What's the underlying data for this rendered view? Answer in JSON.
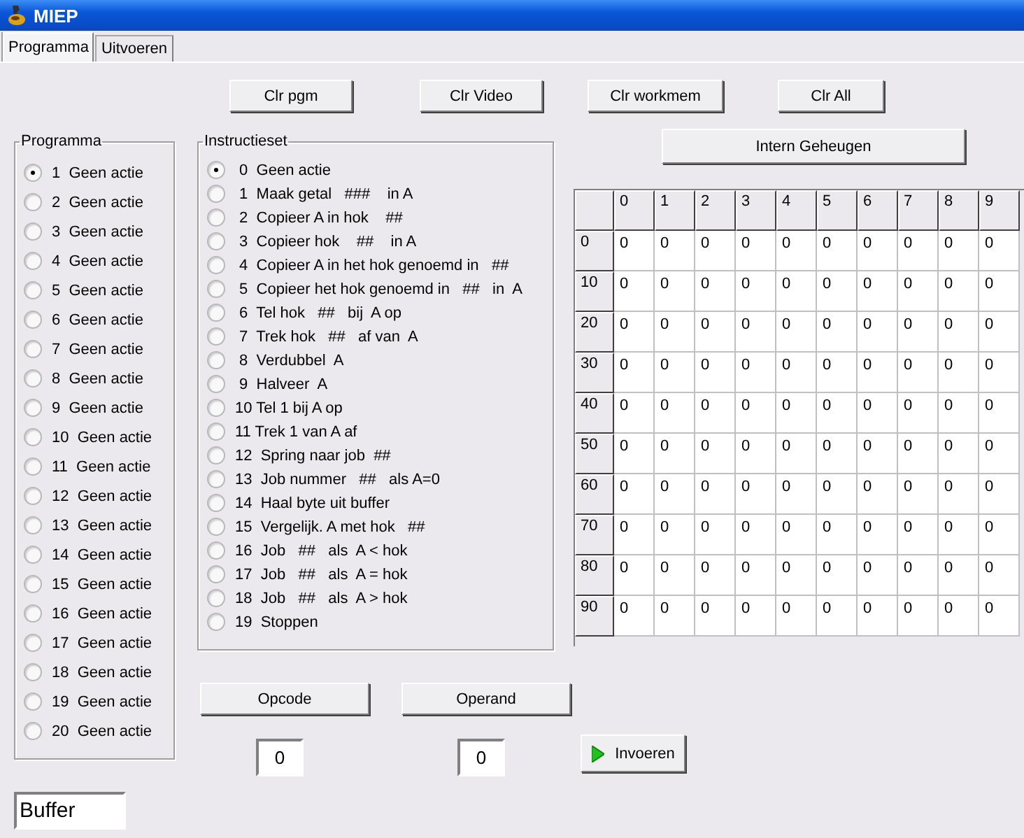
{
  "window": {
    "title": "MIEP"
  },
  "tabs": [
    {
      "label": "Programma",
      "selected": true
    },
    {
      "label": "Uitvoeren",
      "selected": false
    }
  ],
  "toolbar_buttons": [
    "Clr pgm",
    "Clr Video",
    "Clr workmem",
    "Clr All"
  ],
  "program": {
    "title": "Programma",
    "items": [
      {
        "label": "1  Geen actie",
        "selected": true
      },
      {
        "label": "2  Geen actie",
        "selected": false
      },
      {
        "label": "3  Geen actie",
        "selected": false
      },
      {
        "label": "4  Geen actie",
        "selected": false
      },
      {
        "label": "5  Geen actie",
        "selected": false
      },
      {
        "label": "6  Geen actie",
        "selected": false
      },
      {
        "label": "7  Geen actie",
        "selected": false
      },
      {
        "label": "8  Geen actie",
        "selected": false
      },
      {
        "label": "9  Geen actie",
        "selected": false
      },
      {
        "label": "10  Geen actie",
        "selected": false
      },
      {
        "label": "11  Geen actie",
        "selected": false
      },
      {
        "label": "12  Geen actie",
        "selected": false
      },
      {
        "label": "13  Geen actie",
        "selected": false
      },
      {
        "label": "14  Geen actie",
        "selected": false
      },
      {
        "label": "15  Geen actie",
        "selected": false
      },
      {
        "label": "16  Geen actie",
        "selected": false
      },
      {
        "label": "17  Geen actie",
        "selected": false
      },
      {
        "label": "18  Geen actie",
        "selected": false
      },
      {
        "label": "19  Geen actie",
        "selected": false
      },
      {
        "label": "20  Geen actie",
        "selected": false
      }
    ]
  },
  "instruction_set": {
    "title": "Instructieset",
    "items": [
      {
        "label": " 0  Geen actie",
        "selected": true
      },
      {
        "label": " 1  Maak getal   ###    in A",
        "selected": false
      },
      {
        "label": " 2  Copieer A in hok    ##",
        "selected": false
      },
      {
        "label": " 3  Copieer hok    ##    in A",
        "selected": false
      },
      {
        "label": " 4  Copieer A in het hok genoemd in   ##",
        "selected": false
      },
      {
        "label": " 5  Copieer het hok genoemd in   ##   in  A",
        "selected": false
      },
      {
        "label": " 6  Tel hok   ##   bij  A op",
        "selected": false
      },
      {
        "label": " 7  Trek hok   ##   af van  A",
        "selected": false
      },
      {
        "label": " 8  Verdubbel  A",
        "selected": false
      },
      {
        "label": " 9  Halveer  A",
        "selected": false
      },
      {
        "label": "10 Tel 1 bij A op",
        "selected": false
      },
      {
        "label": "11 Trek 1 van A af",
        "selected": false
      },
      {
        "label": "12  Spring naar job  ##",
        "selected": false
      },
      {
        "label": "13  Job nummer   ##   als A=0",
        "selected": false
      },
      {
        "label": "14  Haal byte uit buffer",
        "selected": false
      },
      {
        "label": "15  Vergelijk. A met hok   ##",
        "selected": false
      },
      {
        "label": "16  Job   ##   als  A < hok",
        "selected": false
      },
      {
        "label": "17  Job   ##   als  A = hok",
        "selected": false
      },
      {
        "label": "18  Job   ##   als  A > hok",
        "selected": false
      },
      {
        "label": "19  Stoppen",
        "selected": false
      }
    ]
  },
  "memory": {
    "button": "Intern Geheugen",
    "columns": [
      "0",
      "1",
      "2",
      "3",
      "4",
      "5",
      "6",
      "7",
      "8",
      "9"
    ],
    "rows": [
      {
        "label": "0",
        "cells": [
          "0",
          "0",
          "0",
          "0",
          "0",
          "0",
          "0",
          "0",
          "0",
          "0"
        ]
      },
      {
        "label": "10",
        "cells": [
          "0",
          "0",
          "0",
          "0",
          "0",
          "0",
          "0",
          "0",
          "0",
          "0"
        ]
      },
      {
        "label": "20",
        "cells": [
          "0",
          "0",
          "0",
          "0",
          "0",
          "0",
          "0",
          "0",
          "0",
          "0"
        ]
      },
      {
        "label": "30",
        "cells": [
          "0",
          "0",
          "0",
          "0",
          "0",
          "0",
          "0",
          "0",
          "0",
          "0"
        ]
      },
      {
        "label": "40",
        "cells": [
          "0",
          "0",
          "0",
          "0",
          "0",
          "0",
          "0",
          "0",
          "0",
          "0"
        ]
      },
      {
        "label": "50",
        "cells": [
          "0",
          "0",
          "0",
          "0",
          "0",
          "0",
          "0",
          "0",
          "0",
          "0"
        ]
      },
      {
        "label": "60",
        "cells": [
          "0",
          "0",
          "0",
          "0",
          "0",
          "0",
          "0",
          "0",
          "0",
          "0"
        ]
      },
      {
        "label": "70",
        "cells": [
          "0",
          "0",
          "0",
          "0",
          "0",
          "0",
          "0",
          "0",
          "0",
          "0"
        ]
      },
      {
        "label": "80",
        "cells": [
          "0",
          "0",
          "0",
          "0",
          "0",
          "0",
          "0",
          "0",
          "0",
          "0"
        ]
      },
      {
        "label": "90",
        "cells": [
          "0",
          "0",
          "0",
          "0",
          "0",
          "0",
          "0",
          "0",
          "0",
          "0"
        ]
      }
    ]
  },
  "opcode": {
    "label": "Opcode",
    "value": "0"
  },
  "operand": {
    "label": "Operand",
    "value": "0"
  },
  "submit_button": "Invoeren",
  "buffer": {
    "value": "Buffer"
  }
}
